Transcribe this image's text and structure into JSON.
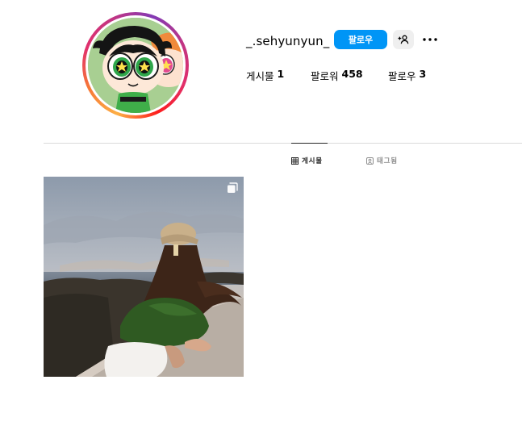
{
  "profile": {
    "username": "_.sehyunyun_",
    "follow_label": "팔로우",
    "suggest_icon": "add-person-icon",
    "more_icon": "more-horizontal-icon"
  },
  "stats": {
    "posts_label": "게시물",
    "posts_count": "1",
    "followers_label": "팔로워",
    "followers_count": "458",
    "following_label": "팔로우",
    "following_count": "3"
  },
  "tabs": {
    "posts_label": "게시물",
    "tagged_label": "태그됨"
  },
  "colors": {
    "accent": "#0095f6",
    "divider": "#dbdbdb",
    "muted": "#8e8e8e"
  }
}
